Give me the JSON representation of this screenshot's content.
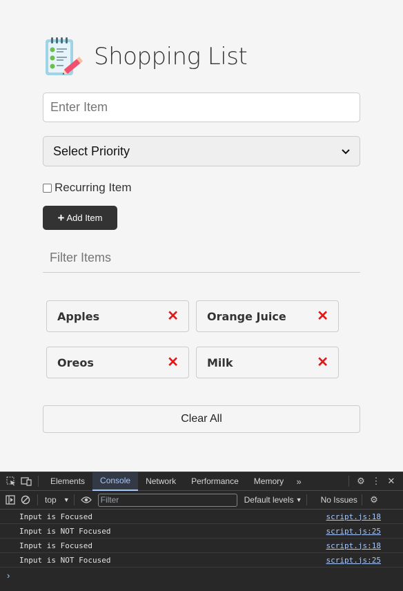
{
  "app": {
    "title": "Shopping List",
    "logo_icon": "notepad-checklist-pencil-icon",
    "item_input_placeholder": "Enter Item",
    "priority_label": "Select Priority",
    "recurring_label": "Recurring Item",
    "add_button_label": "Add Item",
    "filter_placeholder": "Filter Items",
    "items": [
      {
        "name": "Apples"
      },
      {
        "name": "Orange Juice"
      },
      {
        "name": "Oreos"
      },
      {
        "name": "Milk"
      }
    ],
    "clear_button_label": "Clear All",
    "accent_remove_color": "#e01a1a",
    "button_dark_color": "#333333"
  },
  "devtools": {
    "tabs": [
      "Elements",
      "Console",
      "Network",
      "Performance",
      "Memory"
    ],
    "active_tab": "Console",
    "context": "top",
    "filter_placeholder": "Filter",
    "levels": "Default levels",
    "issues": "No Issues",
    "logs": [
      {
        "message": "Input is Focused",
        "source": "script.js:18"
      },
      {
        "message": "Input is NOT Focused",
        "source": "script.js:25"
      },
      {
        "message": "Input is Focused",
        "source": "script.js:18"
      },
      {
        "message": "Input is NOT Focused",
        "source": "script.js:25"
      }
    ],
    "prompt": "›"
  }
}
